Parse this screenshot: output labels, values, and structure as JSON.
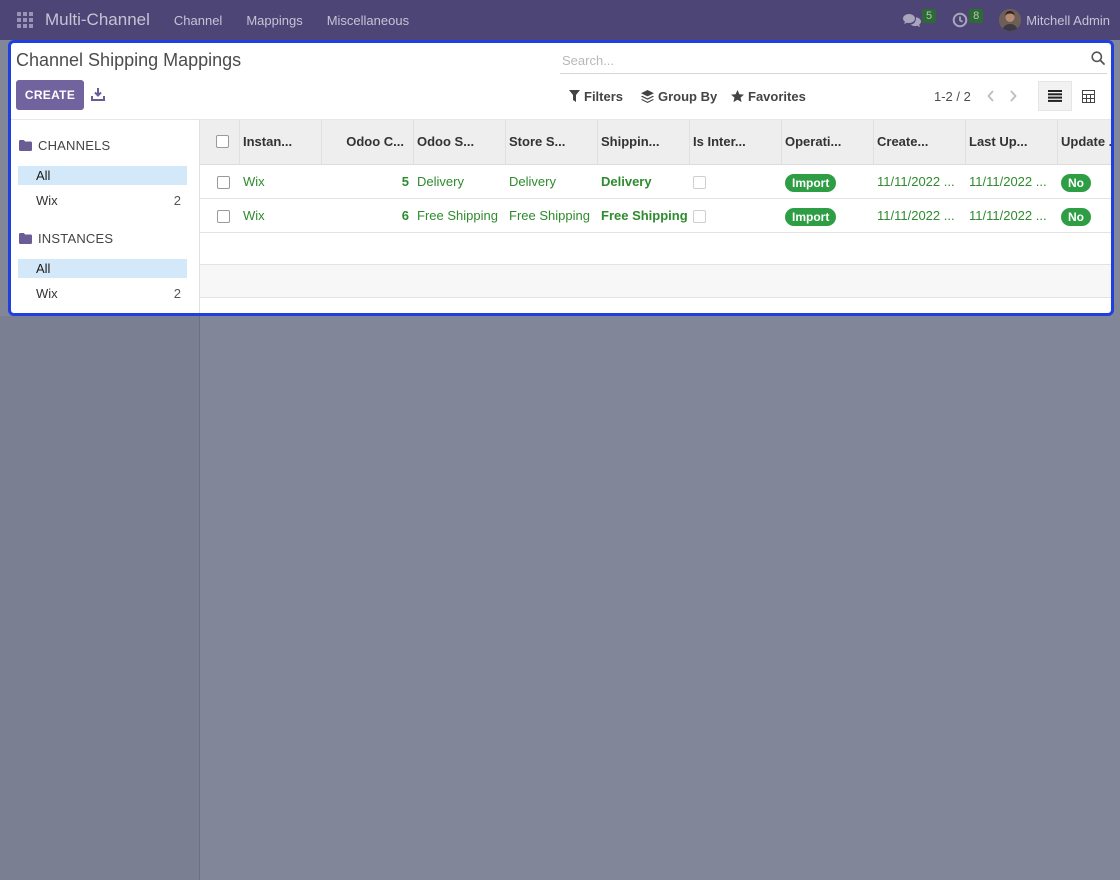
{
  "navbar": {
    "app_name": "Multi-Channel",
    "menus": [
      "Channel",
      "Mappings",
      "Miscellaneous"
    ],
    "messages_count": "5",
    "activities_count": "8",
    "user_name": "Mitchell Admin"
  },
  "control_panel": {
    "title": "Channel Shipping Mappings",
    "search_placeholder": "Search...",
    "create_label": "CREATE",
    "filters_label": "Filters",
    "group_by_label": "Group By",
    "favorites_label": "Favorites",
    "pager_value": "1-2 / 2"
  },
  "search_panel": {
    "sections": [
      {
        "title": "CHANNELS",
        "items": [
          {
            "label": "All",
            "count": ""
          },
          {
            "label": "Wix",
            "count": "2"
          }
        ]
      },
      {
        "title": "INSTANCES",
        "items": [
          {
            "label": "All",
            "count": ""
          },
          {
            "label": "Wix",
            "count": "2"
          }
        ]
      }
    ]
  },
  "table": {
    "columns": [
      "Instan...",
      "Odoo C...",
      "Odoo S...",
      "Store S...",
      "Shippin...",
      "Is Inter...",
      "Operati...",
      "Create...",
      "Last Up...",
      "Update ..."
    ],
    "rows": [
      {
        "instance": "Wix",
        "odoo_carrier_id": "5",
        "odoo_shipping": "Delivery",
        "store_shipping": "Delivery",
        "shipping": "Delivery",
        "operation": "Import",
        "create_date": "11/11/2022 ...",
        "last_update": "11/11/2022 ...",
        "update": "No"
      },
      {
        "instance": "Wix",
        "odoo_carrier_id": "6",
        "odoo_shipping": "Free Shipping",
        "store_shipping": "Free Shipping",
        "shipping": "Free Shipping",
        "operation": "Import",
        "create_date": "11/11/2022 ...",
        "last_update": "11/11/2022 ...",
        "update": "No"
      }
    ]
  },
  "colors": {
    "navbar": "#4d4575",
    "primary": "#71639e",
    "highlight_border": "#1f3fe0",
    "link_green": "#2e8b2e",
    "badge_green": "#2e9e44",
    "active_item": "#d3e8f8",
    "backdrop": "#828699"
  }
}
